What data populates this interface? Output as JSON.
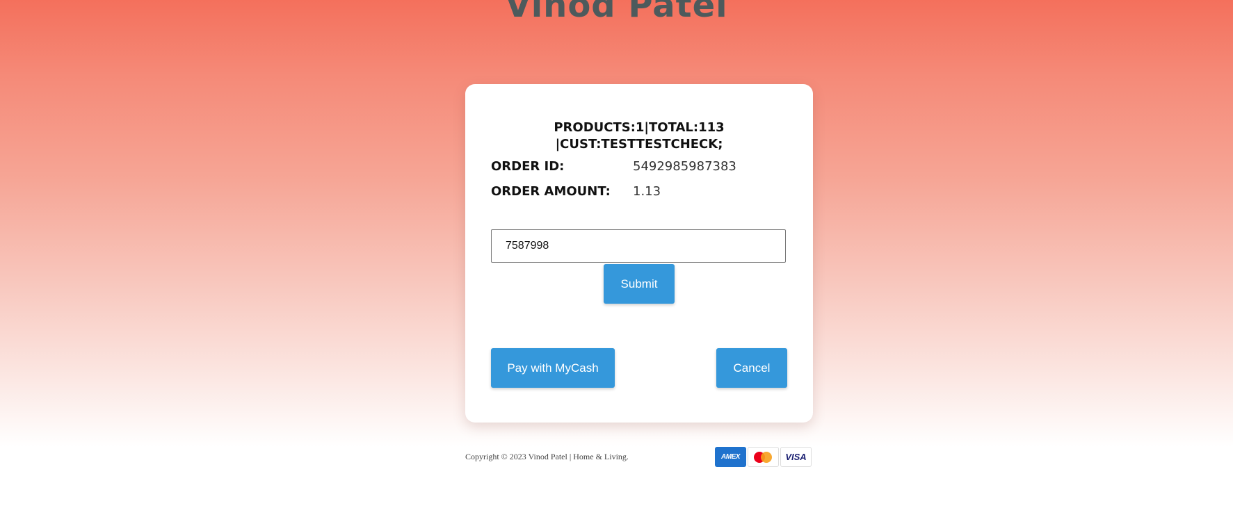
{
  "brand": {
    "name": "Vinod Patel"
  },
  "order": {
    "description_line1": "PRODUCTS:1|TOTAL:113",
    "description_line2": "|CUST:TESTTESTCHECK;",
    "id_label": "ORDER ID:",
    "id_value": "5492985987383",
    "amount_label": "ORDER AMOUNT:",
    "amount_value": "1.13"
  },
  "form": {
    "code_value": "7587998",
    "submit_label": "Submit",
    "pay_label": "Pay with MyCash",
    "cancel_label": "Cancel"
  },
  "footer": {
    "copyright": "Copyright © 2023 Vinod Patel | Home & Living.",
    "payment_cards": [
      {
        "name": "amex-icon",
        "text": "AMEX"
      },
      {
        "name": "mastercard-icon",
        "text": ""
      },
      {
        "name": "visa-icon",
        "text": "VISA"
      }
    ]
  },
  "colors": {
    "accent": "#3598db",
    "background_top": "#f4705c",
    "brand_text": "#4d5a5c"
  }
}
